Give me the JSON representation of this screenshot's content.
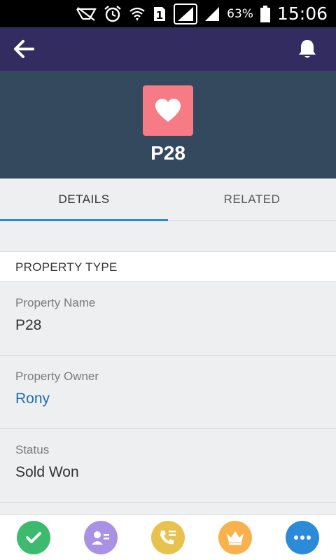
{
  "status_bar": {
    "battery_percent": "63%",
    "time": "15:06",
    "sim_slot": "1",
    "icons": [
      "signal-muted-icon",
      "alarm-icon",
      "wifi-icon",
      "sim-card-icon",
      "cell-signal-icon",
      "cell-signal-icon",
      "battery-icon"
    ]
  },
  "nav": {
    "back_icon": "back-arrow-icon",
    "notification_icon": "bell-icon",
    "color": "#332c61"
  },
  "record": {
    "icon": "heart-icon",
    "icon_color": "#f77b84",
    "title": "P28",
    "header_color": "#34495e"
  },
  "tabs": [
    {
      "label": "DETAILS",
      "selected": true
    },
    {
      "label": "RELATED",
      "selected": false
    }
  ],
  "section": {
    "title": "PROPERTY TYPE"
  },
  "fields": [
    {
      "label": "Property Name",
      "value": "P28"
    },
    {
      "label": "Property Owner",
      "value": "Rony"
    },
    {
      "label": "Status",
      "value": "Sold Won"
    }
  ],
  "actions": [
    {
      "icon": "check-icon",
      "color": "#3eba6e"
    },
    {
      "icon": "contact-card-icon",
      "color": "#a992e3"
    },
    {
      "icon": "log-call-icon",
      "color": "#e8c24f"
    },
    {
      "icon": "crown-icon",
      "color": "#f7b24e"
    },
    {
      "icon": "more-icon",
      "color": "#2b8bd9"
    }
  ]
}
